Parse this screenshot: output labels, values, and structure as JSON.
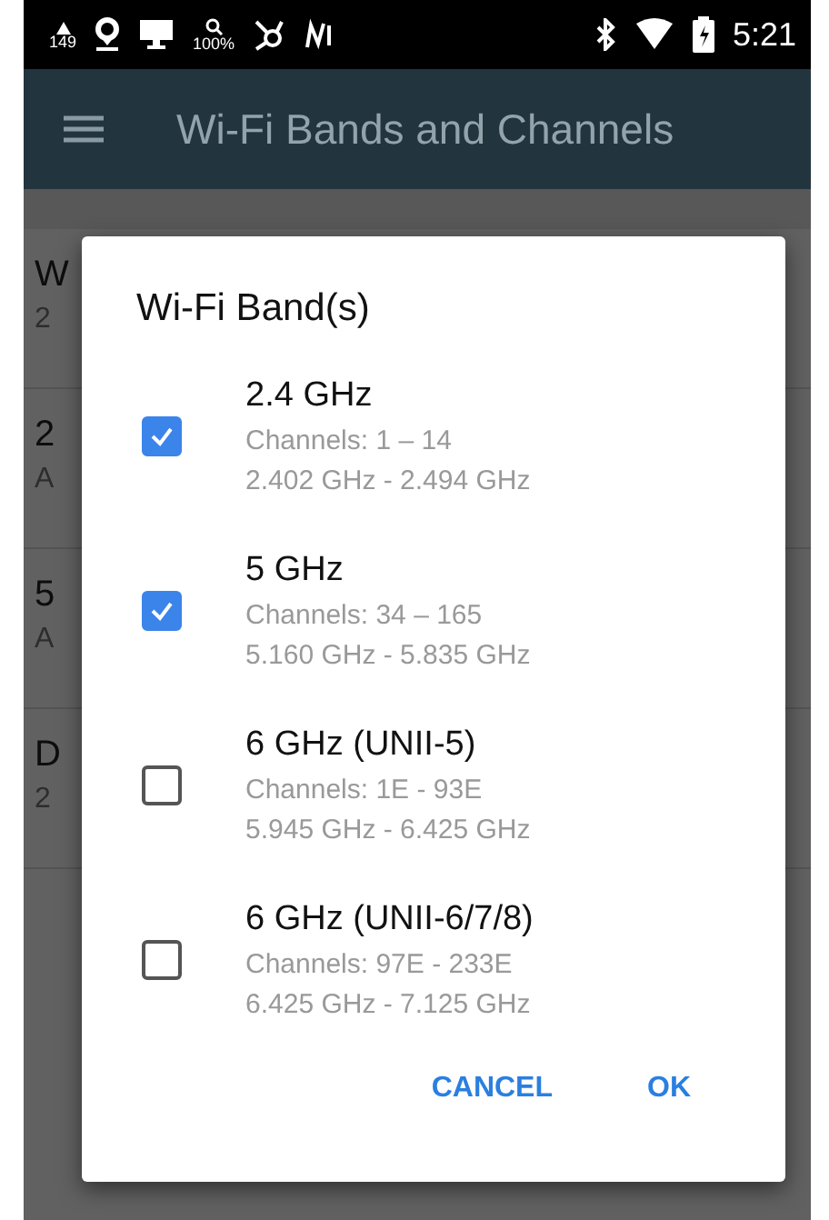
{
  "status_bar": {
    "left_texts": [
      "149",
      "100%"
    ],
    "time": "5:21"
  },
  "app_bar": {
    "title": "Wi-Fi Bands and Channels"
  },
  "list": [
    {
      "title": "W",
      "subtitle": "2"
    },
    {
      "title": "2",
      "subtitle": "A"
    },
    {
      "title": "5",
      "subtitle": "A"
    },
    {
      "title": "D",
      "subtitle": "2"
    }
  ],
  "dialog": {
    "title": "Wi-Fi Band(s)",
    "options": [
      {
        "label": "2.4 GHz",
        "channels": "Channels: 1 – 14",
        "range": "2.402 GHz - 2.494 GHz",
        "checked": true
      },
      {
        "label": "5 GHz",
        "channels": "Channels: 34 – 165",
        "range": "5.160 GHz - 5.835 GHz",
        "checked": true
      },
      {
        "label": "6 GHz (UNII-5)",
        "channels": "Channels: 1E - 93E",
        "range": "5.945 GHz - 6.425 GHz",
        "checked": false
      },
      {
        "label": "6 GHz (UNII-6/7/8)",
        "channels": "Channels: 97E - 233E",
        "range": "6.425 GHz - 7.125 GHz",
        "checked": false
      }
    ],
    "buttons": [
      "CANCEL",
      "OK"
    ]
  }
}
